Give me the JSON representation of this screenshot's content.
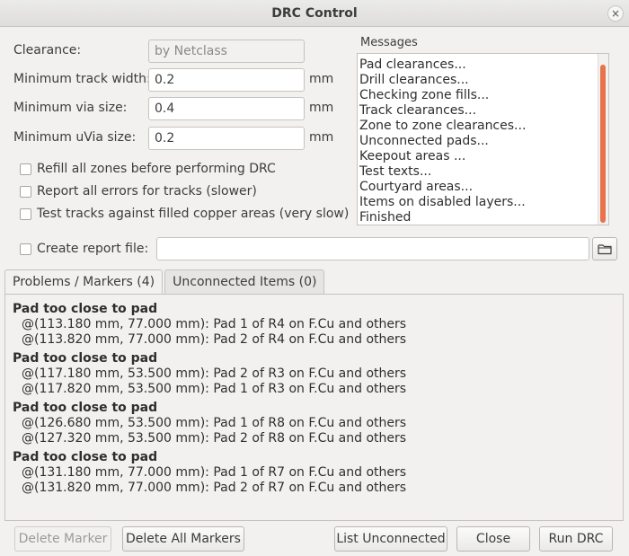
{
  "window": {
    "title": "DRC Control",
    "close_glyph": "×"
  },
  "form": {
    "clearance_label": "Clearance:",
    "clearance_value": "by Netclass",
    "track_width_label": "Minimum track width:",
    "track_width_value": "0.2",
    "via_size_label": "Minimum via size:",
    "via_size_value": "0.4",
    "uvia_size_label": "Minimum uVia size:",
    "uvia_size_value": "0.2",
    "unit": "mm"
  },
  "options": {
    "refill": "Refill all zones before performing DRC",
    "report_all": "Report all errors for tracks (slower)",
    "test_tracks": "Test tracks against filled copper areas (very slow)",
    "create_report": "Create report file:",
    "report_path": ""
  },
  "messages": {
    "label": "Messages",
    "items": [
      "Pad clearances...",
      "Drill clearances...",
      "Checking zone fills...",
      "Track clearances...",
      "Zone to zone clearances...",
      "Unconnected pads...",
      "Keepout areas ...",
      "Test texts...",
      "Courtyard areas...",
      "Items on disabled layers...",
      "Finished"
    ]
  },
  "tabs": [
    {
      "label": "Problems / Markers (4)"
    },
    {
      "label": "Unconnected Items (0)"
    }
  ],
  "markers": [
    {
      "title": "Pad too close to pad",
      "lines": [
        "@(113.180 mm, 77.000 mm): Pad 1 of R4 on F.Cu and others",
        "@(113.820 mm, 77.000 mm): Pad 2 of R4 on F.Cu and others"
      ]
    },
    {
      "title": "Pad too close to pad",
      "lines": [
        "@(117.180 mm, 53.500 mm): Pad 2 of R3 on F.Cu and others",
        "@(117.820 mm, 53.500 mm): Pad 1 of R3 on F.Cu and others"
      ]
    },
    {
      "title": "Pad too close to pad",
      "lines": [
        "@(126.680 mm, 53.500 mm): Pad 1 of R8 on F.Cu and others",
        "@(127.320 mm, 53.500 mm): Pad 2 of R8 on F.Cu and others"
      ]
    },
    {
      "title": "Pad too close to pad",
      "lines": [
        "@(131.180 mm, 77.000 mm): Pad 1 of R7 on F.Cu and others",
        "@(131.820 mm, 77.000 mm): Pad 2 of R7 on F.Cu and others"
      ]
    }
  ],
  "buttons": {
    "delete_marker": "Delete Marker",
    "delete_all": "Delete All Markers",
    "list_unconnected": "List Unconnected",
    "close": "Close",
    "run_drc": "Run DRC"
  },
  "colors": {
    "scroll_accent": "#e8734a"
  }
}
